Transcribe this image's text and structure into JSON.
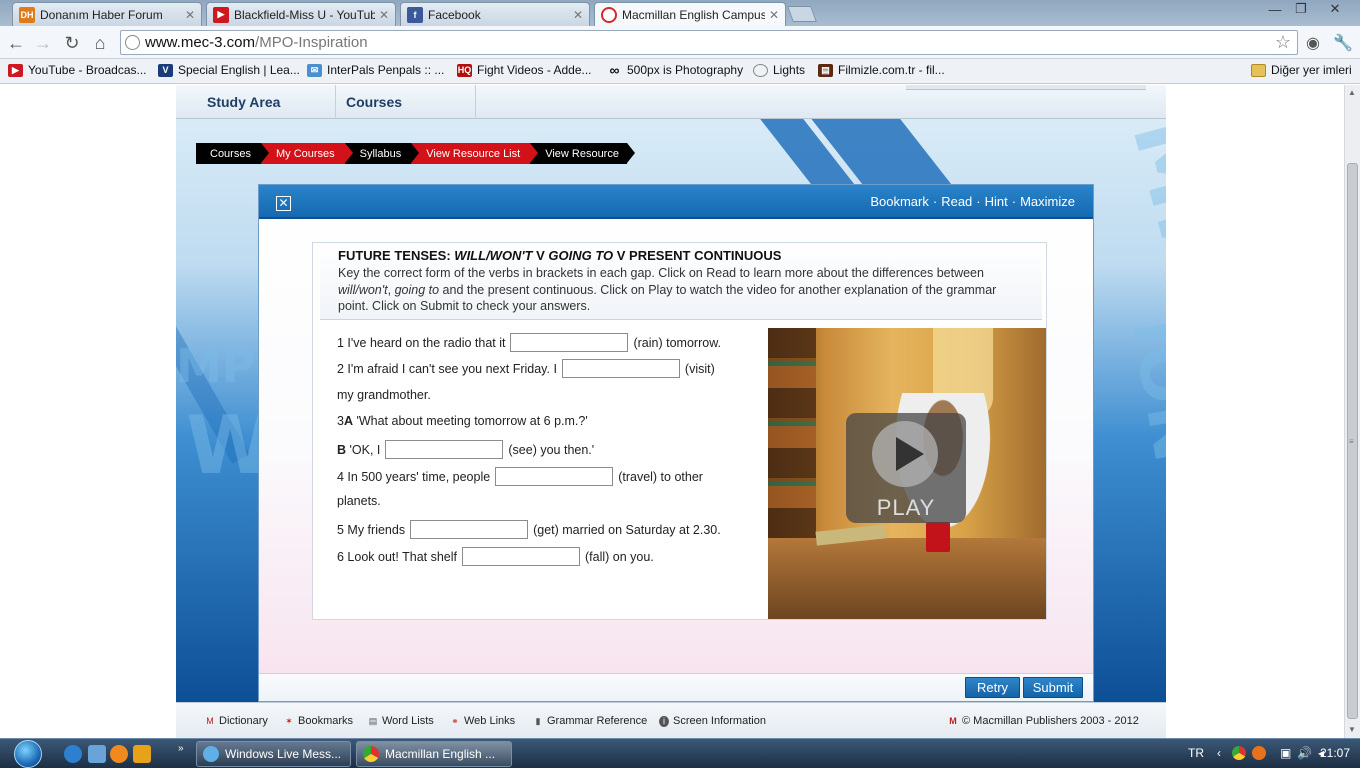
{
  "browser": {
    "tabs": [
      {
        "title": "Donanım Haber Forum",
        "icon": "dh-icon",
        "icon_text": "DH",
        "color": "#e07b1a"
      },
      {
        "title": "Blackfield-Miss U - YouTub",
        "icon": "youtube-icon",
        "icon_text": "",
        "color": "#cc181e"
      },
      {
        "title": "Facebook",
        "icon": "facebook-icon",
        "icon_text": "f",
        "color": "#3b5998"
      },
      {
        "title": "Macmillan English Campus",
        "icon": "macmillan-icon",
        "icon_text": "",
        "color": "#d32a2a"
      }
    ],
    "url_host": "www.mec-3.com",
    "url_path": "/MPO-Inspiration",
    "bookmarks": [
      {
        "label": "YouTube - Broadcas...",
        "icon": "youtube-icon",
        "color": "#cc181e"
      },
      {
        "label": "Special English | Lea...",
        "icon": "voa-icon",
        "color": "#1a3d7a"
      },
      {
        "label": "InterPals Penpals :: ...",
        "icon": "mail-icon",
        "color": "#4a8fd0"
      },
      {
        "label": "Fight Videos - Adde...",
        "icon": "hq-icon",
        "color": "#b01010"
      },
      {
        "label": "500px is Photography",
        "icon": "infinity-icon",
        "color": "#111111"
      },
      {
        "label": "Lights",
        "icon": "globe-icon",
        "color": "#888888"
      },
      {
        "label": "Filmizle.com.tr - fil...",
        "icon": "film-icon",
        "color": "#5a2a10"
      }
    ],
    "other_bookmarks": "Diğer yer imleri"
  },
  "site": {
    "nav": [
      "Study Area",
      "Courses"
    ],
    "breadcrumbs": [
      "Courses",
      "My Courses",
      "Syllabus",
      "View Resource List",
      "View Resource"
    ],
    "activity_links": [
      "Bookmark",
      "Read",
      "Hint",
      "Maximize"
    ],
    "exercise": {
      "title_parts": [
        "FUTURE TENSES: ",
        "WILL/WON'T",
        " V ",
        "GOING TO",
        " V PRESENT CONTINUOUS"
      ],
      "instruction_1": "Key the correct form of the verbs in brackets in each gap. Click on Read to learn more about the differences between ",
      "instruction_em1": "will/won't",
      "instruction_2": ", ",
      "instruction_em2": "going to",
      "instruction_3": " and the present continuous. Click on Play to watch the video for another explanation of the grammar point. Click on Submit to check your answers.",
      "questions": [
        {
          "before": "1 I've heard on the radio that it",
          "after": "(rain) tomorrow."
        },
        {
          "before": "2 I'm afraid I can't see you next Friday. I",
          "after": "(visit)"
        },
        {
          "text": "my grandmother."
        },
        {
          "bold": "A",
          "text": "'What about meeting tomorrow at 6 p.m.?'",
          "prefix": "3 "
        },
        {
          "bold": "B",
          "before": "'OK, I",
          "after": "(see) you then.'"
        },
        {
          "before": "4 In 500 years' time, people",
          "after": "(travel) to other"
        },
        {
          "text": "planets."
        },
        {
          "before": "5 My friends",
          "after": "(get) married on Saturday at 2.30."
        },
        {
          "before": "6 Look out! That shelf",
          "after": "(fall) on you."
        }
      ],
      "play_label": "PLAY"
    },
    "buttons": {
      "retry": "Retry",
      "submit": "Submit"
    },
    "footer_links": [
      {
        "label": "Dictionary",
        "icon": "dictionary-icon"
      },
      {
        "label": "Bookmarks",
        "icon": "bookmark-icon"
      },
      {
        "label": "Word Lists",
        "icon": "wordlist-icon"
      },
      {
        "label": "Web Links",
        "icon": "weblink-icon"
      },
      {
        "label": "Grammar Reference",
        "icon": "grammar-icon"
      },
      {
        "label": "Screen Information",
        "icon": "info-icon"
      }
    ],
    "copyright": "© Macmillan Publishers 2003 - 2012"
  },
  "taskbar": {
    "tasks": [
      "Windows Live Mess...",
      "Macmillan English ..."
    ],
    "lang": "TR",
    "time": "21:07"
  }
}
